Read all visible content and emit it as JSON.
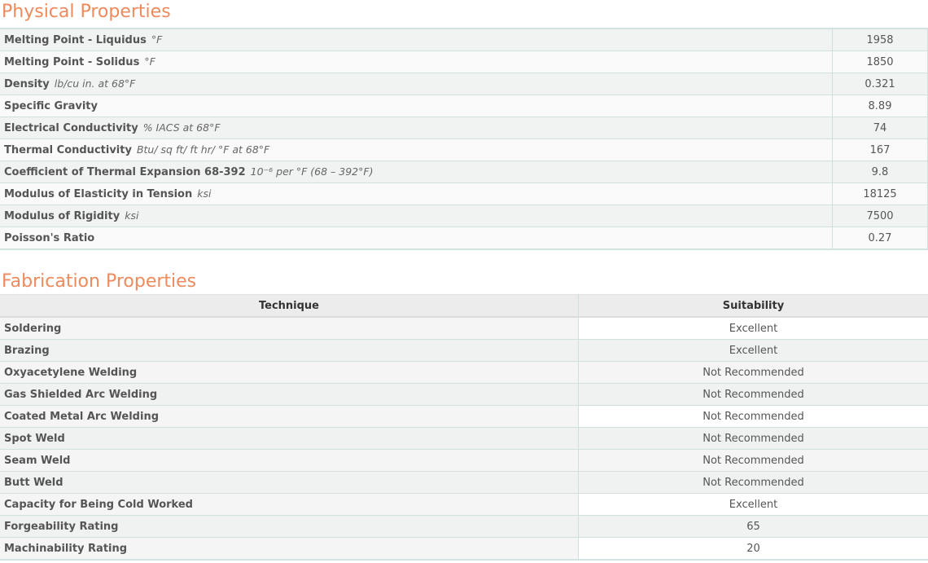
{
  "physical": {
    "title": "Physical Properties",
    "rows": [
      {
        "name": "Melting Point - Liquidus",
        "unit": "°F",
        "value": "1958"
      },
      {
        "name": "Melting Point - Solidus",
        "unit": "°F",
        "value": "1850"
      },
      {
        "name": "Density",
        "unit": "lb/cu in. at 68°F",
        "value": "0.321"
      },
      {
        "name": "Specific Gravity",
        "unit": "",
        "value": "8.89"
      },
      {
        "name": "Electrical Conductivity",
        "unit": "% IACS at 68°F",
        "value": "74"
      },
      {
        "name": "Thermal Conductivity",
        "unit": "Btu/ sq ft/ ft hr/ °F at 68°F",
        "value": "167"
      },
      {
        "name": "Coefficient of Thermal Expansion 68-392",
        "unit": "10⁻⁶ per °F (68 – 392°F)",
        "value": "9.8"
      },
      {
        "name": "Modulus of Elasticity in Tension",
        "unit": "ksi",
        "value": "18125"
      },
      {
        "name": "Modulus of Rigidity",
        "unit": "ksi",
        "value": "7500"
      },
      {
        "name": "Poisson's Ratio",
        "unit": "",
        "value": "0.27"
      }
    ]
  },
  "fabrication": {
    "title": "Fabrication Properties",
    "headers": {
      "technique": "Technique",
      "suitability": "Suitability"
    },
    "rows": [
      {
        "technique": "Soldering",
        "suitability": "Excellent"
      },
      {
        "technique": "Brazing",
        "suitability": "Excellent"
      },
      {
        "technique": "Oxyacetylene Welding",
        "suitability": "Not Recommended"
      },
      {
        "technique": "Gas Shielded Arc Welding",
        "suitability": "Not Recommended"
      },
      {
        "technique": "Coated Metal Arc Welding",
        "suitability": "Not Recommended"
      },
      {
        "technique": "Spot Weld",
        "suitability": "Not Recommended"
      },
      {
        "technique": "Seam Weld",
        "suitability": "Not Recommended"
      },
      {
        "technique": "Butt Weld",
        "suitability": "Not Recommended"
      },
      {
        "technique": "Capacity for Being Cold Worked",
        "suitability": "Excellent"
      },
      {
        "technique": "Forgeability Rating",
        "suitability": "65"
      },
      {
        "technique": "Machinability Rating",
        "suitability": "20"
      }
    ]
  },
  "colors": {
    "title": "#ee8a5c",
    "border": "#cfe0de"
  }
}
